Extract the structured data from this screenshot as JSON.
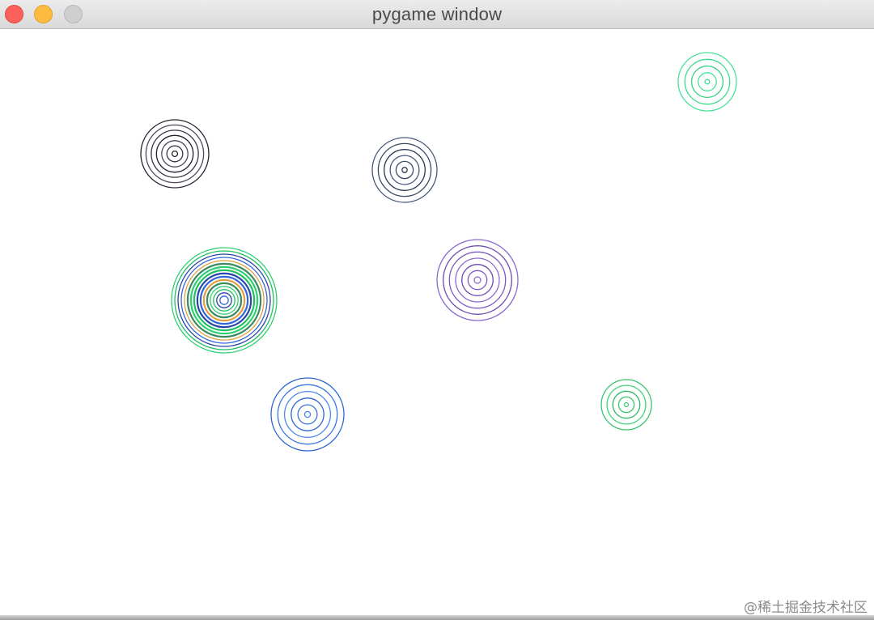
{
  "window": {
    "title": "pygame window",
    "buttons": {
      "close": "close",
      "minimize": "minimize",
      "zoom": "zoom"
    }
  },
  "watermark": "@稀土掘金技术社区",
  "ripples": [
    {
      "name": "ripple-black",
      "colors": [
        "#2a2230",
        "#3c3340",
        "#51465a"
      ],
      "rings": 7
    },
    {
      "name": "ripple-navy",
      "colors": [
        "#2d3a55",
        "#3a4a66",
        "#4a5a7a"
      ],
      "rings": 6
    },
    {
      "name": "ripple-mint-top",
      "colors": [
        "#3ddc8e",
        "#45e39a",
        "#2fcf80"
      ],
      "rings": 5
    },
    {
      "name": "ripple-green-blue-large",
      "colors": [
        "#3366dd",
        "#2a44aa",
        "#20c060",
        "#2dd070",
        "#3a8a60",
        "#e0a040"
      ],
      "rings": 16
    },
    {
      "name": "ripple-purple",
      "colors": [
        "#8a6ad0",
        "#7a5ac0",
        "#6a4ab0"
      ],
      "rings": 7
    },
    {
      "name": "ripple-blue",
      "colors": [
        "#4a86f0",
        "#3a76e0",
        "#2a66d0"
      ],
      "rings": 6
    },
    {
      "name": "ripple-green-right",
      "colors": [
        "#3fd37a",
        "#34c56c",
        "#2db862"
      ],
      "rings": 5
    }
  ]
}
